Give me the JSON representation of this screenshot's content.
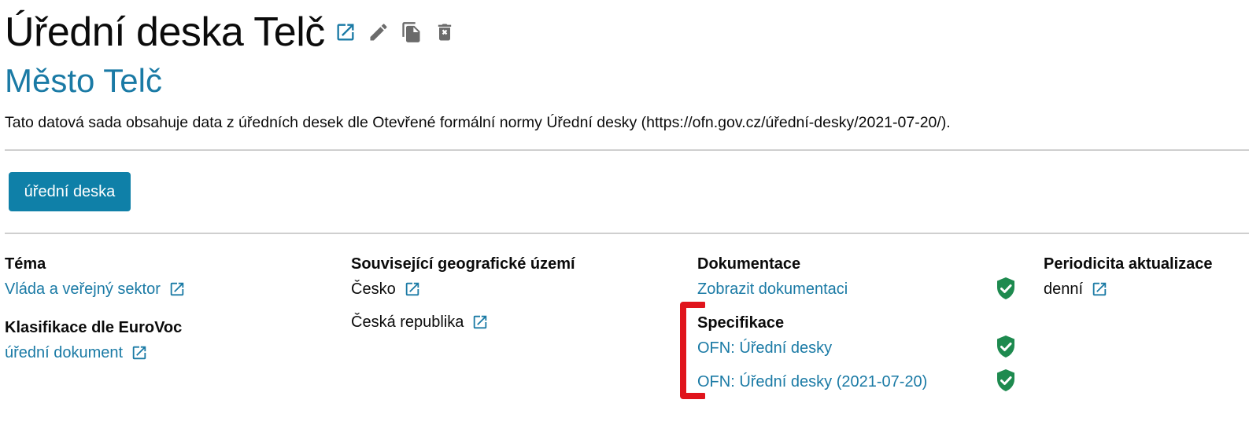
{
  "dataset": {
    "title": "Úřední deska Telč",
    "publisher": "Město Telč",
    "description": "Tato datová sada obsahuje data z úředních desek dle Otevřené formální normy Úřední desky (https://ofn.gov.cz/úřední-desky/2021-07-20/).",
    "actions": [
      "external-link-icon",
      "edit-icon",
      "copy-icon",
      "delete-icon"
    ]
  },
  "distribution": {
    "button_label": "úřední deska"
  },
  "metadata": {
    "theme": {
      "label": "Téma",
      "value": "Vláda a veřejný sektor"
    },
    "eurovoc": {
      "label": "Klasifikace dle EuroVoc",
      "value": "úřední dokument"
    },
    "geo": {
      "label": "Související geografické území",
      "values": [
        "Česko",
        "Česká republika"
      ]
    },
    "documentation": {
      "label": "Dokumentace",
      "value": "Zobrazit dokumentaci"
    },
    "specification": {
      "label": "Specifikace",
      "values": [
        "OFN: Úřední desky",
        "OFN: Úřední desky (2021-07-20)"
      ]
    },
    "periodicity": {
      "label": "Periodicita aktualizace",
      "value": "denní"
    }
  },
  "colors": {
    "link": "#1a7aa5",
    "button": "#0f80a8",
    "shield": "#1e8a4f",
    "annotation": "#e0141c"
  }
}
